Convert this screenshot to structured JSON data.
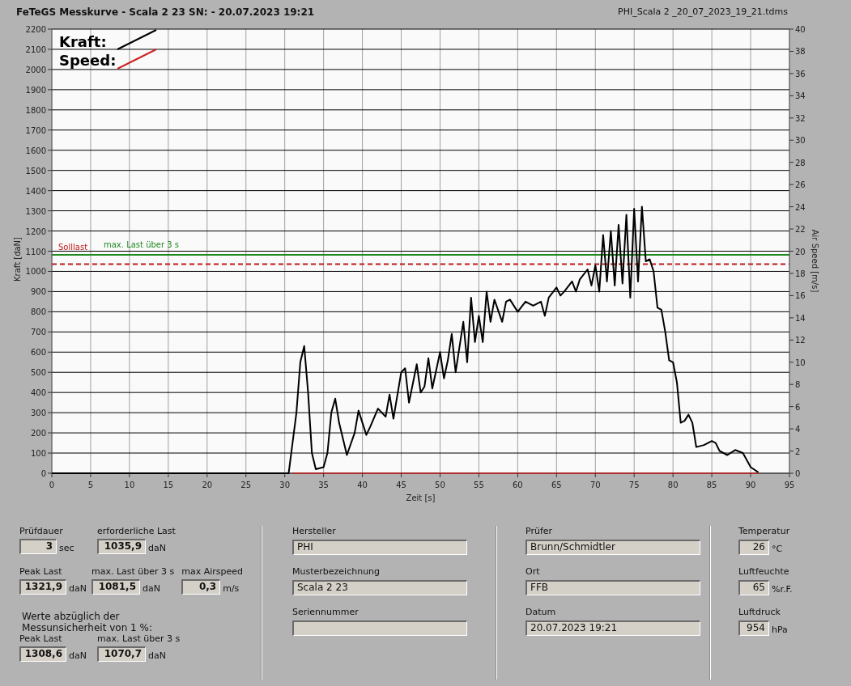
{
  "header": {
    "title": "FeTeGS Messkurve - Scala 2 23  SN:  - 20.07.2023 19:21",
    "file": "PHI_Scala 2 _20_07_2023_19_21.tdms"
  },
  "chart": {
    "chart_data": {
      "type": "line",
      "xlabel": "Zeit [s]",
      "ylabel": "Kraft [daN]",
      "y2label": "Air Speed [m/s]",
      "x": [
        0,
        5,
        10,
        15,
        20,
        25,
        30,
        30.5,
        31,
        31.5,
        32,
        32.5,
        33,
        33.5,
        34,
        35,
        35.5,
        36,
        36.5,
        37,
        38,
        39,
        39.5,
        40,
        40.5,
        41,
        42,
        43,
        43.5,
        44,
        45,
        45.5,
        46,
        47,
        47.5,
        48,
        48.5,
        49,
        50,
        50.5,
        51,
        51.5,
        52,
        53,
        53.5,
        54,
        54.5,
        55,
        55.5,
        56,
        56.5,
        57,
        58,
        58.5,
        59,
        60,
        61,
        62,
        63,
        63.5,
        64,
        65,
        65.5,
        66,
        67,
        67.5,
        68,
        69,
        69.5,
        70,
        70.5,
        71,
        71.5,
        72,
        72.5,
        73,
        73.5,
        74,
        74.5,
        75,
        75.5,
        76,
        76.5,
        77,
        77.5,
        78,
        78.5,
        79,
        79.5,
        80,
        80.5,
        81,
        81.5,
        82,
        82.5,
        83,
        84,
        85,
        85.5,
        86,
        87,
        88,
        89,
        90,
        91
      ],
      "series": [
        {
          "name": "Kraft:",
          "color": "#000000",
          "values": [
            0,
            0,
            0,
            0,
            0,
            0,
            0,
            0,
            150,
            300,
            550,
            630,
            400,
            100,
            20,
            30,
            100,
            300,
            370,
            250,
            90,
            200,
            310,
            250,
            190,
            230,
            320,
            280,
            390,
            270,
            500,
            520,
            350,
            540,
            400,
            430,
            570,
            420,
            600,
            470,
            560,
            690,
            500,
            750,
            550,
            870,
            650,
            780,
            650,
            900,
            750,
            860,
            750,
            850,
            860,
            800,
            850,
            830,
            850,
            780,
            870,
            920,
            880,
            900,
            950,
            900,
            960,
            1010,
            930,
            1030,
            900,
            1180,
            950,
            1200,
            930,
            1230,
            940,
            1280,
            870,
            1310,
            950,
            1320,
            1050,
            1060,
            1000,
            820,
            810,
            700,
            560,
            550,
            450,
            250,
            260,
            290,
            250,
            130,
            140,
            160,
            150,
            110,
            90,
            115,
            100,
            30,
            5
          ]
        },
        {
          "name": "Speed:",
          "color": "#cc2222",
          "values": [
            null,
            null,
            null,
            null,
            null,
            null,
            null,
            null,
            0,
            0,
            0,
            0,
            0,
            0,
            0,
            0,
            0,
            0,
            0,
            0,
            0,
            0,
            0,
            0,
            0,
            0,
            0,
            0,
            0,
            0,
            0,
            0,
            0,
            0,
            0,
            0,
            0,
            0,
            0,
            0,
            0,
            0,
            0,
            0,
            0,
            0,
            0,
            0,
            0,
            0,
            0,
            0,
            0,
            0,
            0,
            0,
            0,
            0,
            0,
            0,
            0,
            0,
            0,
            0,
            0,
            0,
            0,
            0,
            0,
            0,
            0,
            0,
            0,
            0,
            0,
            0,
            0,
            0,
            0,
            0,
            0,
            0,
            0,
            0,
            0,
            0,
            0,
            0,
            0,
            0,
            0,
            0,
            0,
            0,
            0,
            0,
            0,
            0,
            0,
            0,
            0,
            0,
            0,
            0,
            0
          ]
        }
      ],
      "xlim": [
        0,
        95
      ],
      "ylim": [
        0,
        2200
      ],
      "y2lim": [
        0,
        40
      ],
      "xticks": [
        0,
        5,
        10,
        15,
        20,
        25,
        30,
        35,
        40,
        45,
        50,
        55,
        60,
        65,
        70,
        75,
        80,
        85,
        90,
        95
      ],
      "yticks": [
        0,
        100,
        200,
        300,
        400,
        500,
        600,
        700,
        800,
        900,
        1000,
        1100,
        1200,
        1300,
        1400,
        1500,
        1600,
        1700,
        1800,
        1900,
        2000,
        2100,
        2200
      ],
      "y2ticks": [
        0,
        2,
        4,
        6,
        8,
        10,
        12,
        14,
        16,
        18,
        20,
        22,
        24,
        26,
        28,
        30,
        32,
        34,
        36,
        38,
        40
      ],
      "grid": true,
      "legend": true,
      "ref_lines": [
        {
          "axis": "y",
          "value": 1081.5,
          "label": "max. Last über  3 s",
          "color": "#1e8a1e"
        },
        {
          "axis": "y",
          "value": 1035.9,
          "label": "Solllast",
          "color": "#c01818"
        }
      ]
    }
  },
  "results": {
    "rows": [
      [
        {
          "label": "Prüfdauer",
          "value": "3",
          "unit": "sec"
        },
        {
          "label": "erforderliche Last",
          "value": "1035,9",
          "unit": "daN"
        }
      ],
      [
        {
          "label": "Peak Last",
          "value": "1321,9",
          "unit": "daN"
        },
        {
          "label": "max. Last über  3 s",
          "value": "1081,5",
          "unit": "daN"
        },
        {
          "label": "max Airspeed",
          "value": "0,3",
          "unit": "m/s"
        }
      ]
    ],
    "note": "Werte abzüglich der Messunsicherheit von 1  %:",
    "corrected": [
      {
        "label": "Peak Last",
        "value": "1308,6",
        "unit": "daN"
      },
      {
        "label": "max. Last über  3 s",
        "value": "1070,7",
        "unit": "daN"
      }
    ]
  },
  "sample": [
    {
      "label": "Hersteller",
      "value": "PHI"
    },
    {
      "label": "Musterbezeichnung",
      "value": "Scala 2 23"
    },
    {
      "label": "Seriennummer"
    }
  ],
  "test": [
    {
      "label": "Prüfer",
      "value": "Brunn/Schmidtler"
    },
    {
      "label": "Ort",
      "value": "FFB"
    },
    {
      "label": "Datum",
      "value": "20.07.2023 19:21"
    }
  ],
  "environment": [
    {
      "label": "Temperatur",
      "value": "26",
      "unit": "°C"
    },
    {
      "label": "Luftfeuchte",
      "value": "65",
      "unit": "%r.F."
    },
    {
      "label": "Luftdruck",
      "value": "954",
      "unit": "hPa"
    }
  ]
}
